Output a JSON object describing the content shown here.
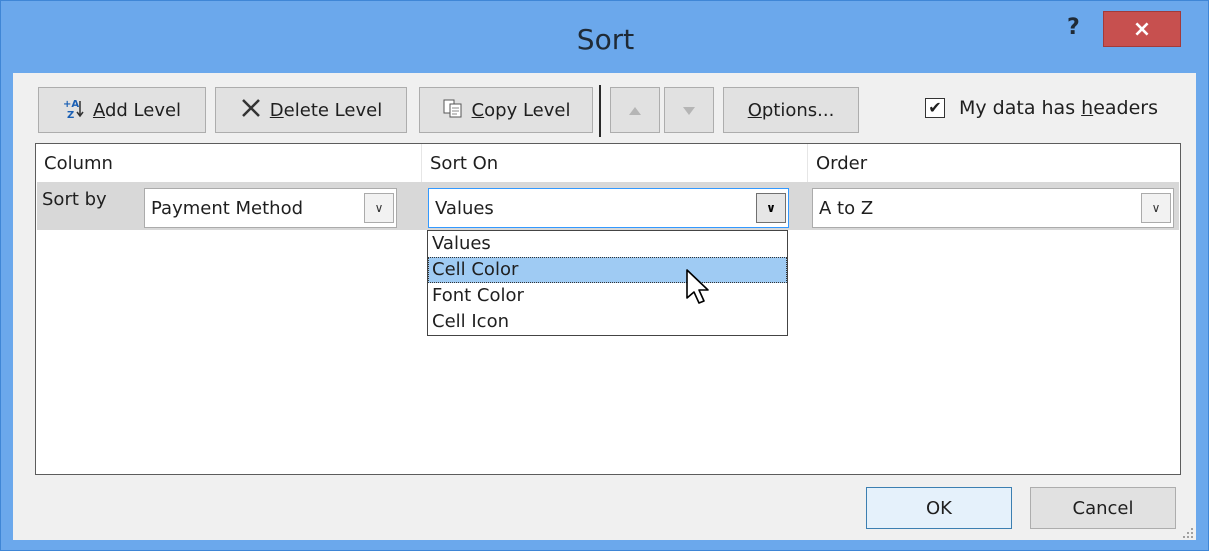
{
  "window": {
    "title": "Sort",
    "help_label": "?",
    "close_label": "×"
  },
  "toolbar": {
    "add_level": {
      "prefix": "",
      "mnemonic": "A",
      "rest": "dd Level"
    },
    "delete_level": {
      "mnemonic": "D",
      "rest": "elete Level"
    },
    "copy_level": {
      "mnemonic": "C",
      "rest": "opy Level"
    },
    "options": {
      "mnemonic": "O",
      "rest": "ptions..."
    },
    "headers_checkbox": {
      "checked": true,
      "check_mark": "✔",
      "label_pre": "My data has ",
      "mnemonic": "h",
      "label_post": "eaders"
    }
  },
  "grid": {
    "headers": [
      "Column",
      "Sort On",
      "Order"
    ],
    "row": {
      "label": "Sort by",
      "column_value": "Payment Method",
      "sort_on_value": "Values",
      "order_value": "A to Z"
    }
  },
  "dropdown": {
    "options": [
      "Values",
      "Cell Color",
      "Font Color",
      "Cell Icon"
    ],
    "highlighted": "Cell Color"
  },
  "footer": {
    "ok_label": "OK",
    "cancel_label": "Cancel"
  }
}
